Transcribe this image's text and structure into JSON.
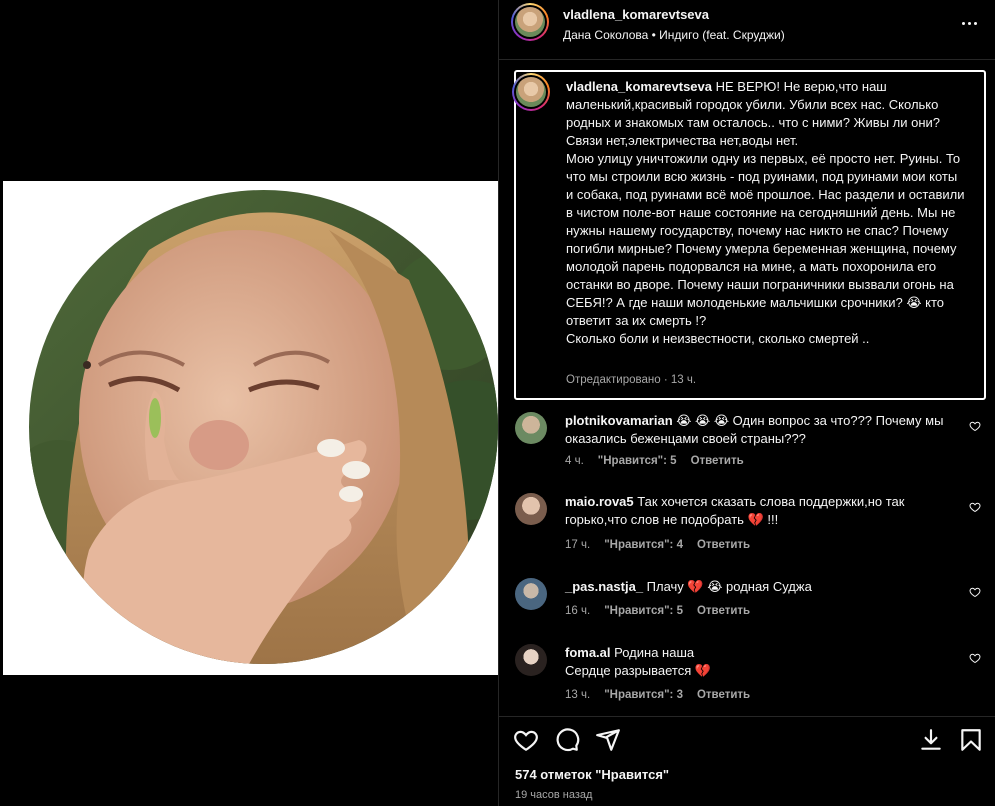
{
  "post": {
    "username": "vladlena_komarevtseva",
    "audio": "Дана Соколова • Индиго (feat. Скруджи)",
    "caption": {
      "username": "vladlena_komarevtseva",
      "text": "НЕ ВЕРЮ! Не верю,что наш маленький,красивый городок убили. Убили всех нас. Сколько родных и знакомых там осталось.. что с ними? Живы ли они? Связи нет,электричества нет,воды нет.\nМою улицу уничтожили одну из первых, её просто нет. Руины. То что мы строили всю жизнь - под руинами, под руинами мои коты и собака, под руинами всё моё прошлое. Нас раздели и оставили в чистом поле-вот наше состояние на сегодняшний день. Мы не нужны нашему государству, почему нас никто не спас? Почему погибли мирные? Почему умерла беременная женщина, почему молодой парень подорвался на мине, а мать похоронила его останки во дворе. Почему наши пограничники вызвали огонь на СЕБЯ!? А где наши молоденькие мальчишки срочники? 😭 кто ответит за их смерть !?\nСколько боли и неизвестности, сколько смертей ..",
      "meta": "Отредактировано · 13 ч."
    },
    "comments": [
      {
        "username": "plotnikovamarian",
        "text": " 😭 😭 😭 Один вопрос за что??? Почему мы оказались беженцами своей страны???",
        "time": "4 ч.",
        "likes": "\"Нравится\": 5",
        "reply": "Ответить"
      },
      {
        "username": "maio.rova5",
        "text": " Так хочется сказать слова поддержки,но так горько,что слов не подобрать 💔 !!!",
        "time": "17 ч.",
        "likes": "\"Нравится\": 4",
        "reply": "Ответить"
      },
      {
        "username": "_pas.nastja_",
        "text": " Плачу 💔 😭 родная Суджа",
        "time": "16 ч.",
        "likes": "\"Нравится\": 5",
        "reply": "Ответить"
      },
      {
        "username": "foma.al",
        "text": " Родина наша\nСердце разрывается 💔",
        "time": "13 ч.",
        "likes": "\"Нравится\": 3",
        "reply": "Ответить"
      }
    ],
    "likes_count": "574 отметок \"Нравится\"",
    "posted": "19 часов назад"
  },
  "icons": {
    "like": "heart-icon",
    "comment": "comment-icon",
    "share": "send-icon",
    "save": "bookmark-icon",
    "more": "more-icon"
  },
  "colors": {
    "background": "#000000",
    "text": "#f5f5f5",
    "muted": "#a8a8a8",
    "divider": "#262626"
  }
}
